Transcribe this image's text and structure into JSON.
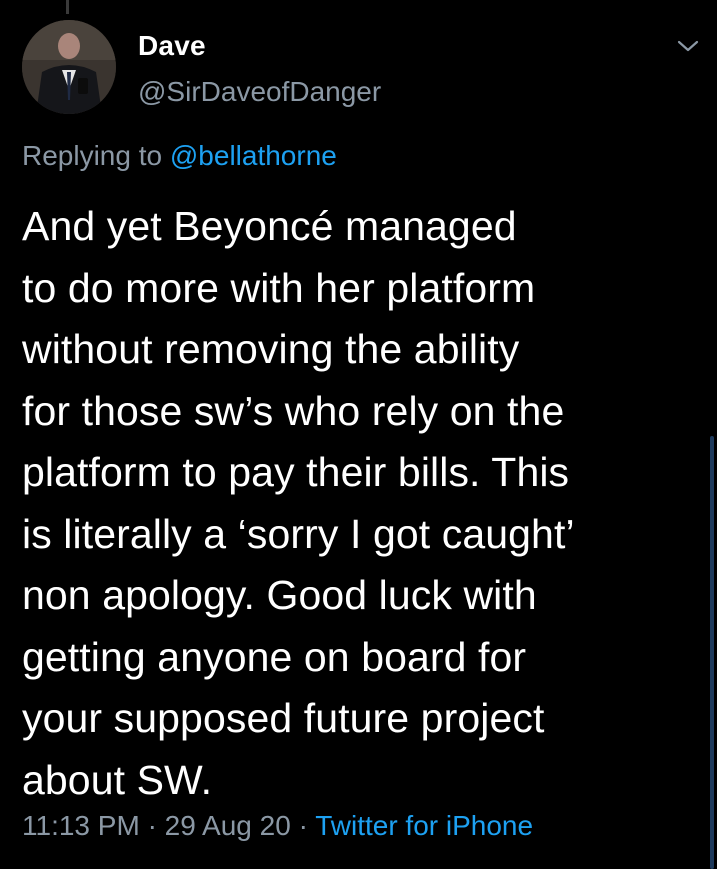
{
  "author": {
    "name": "Dave",
    "handle": "@SirDaveofDanger"
  },
  "reply": {
    "prefix": "Replying to",
    "to": "@bellathorne"
  },
  "tweet": {
    "text": "And yet Beyoncé managed\nto do more with her platform\nwithout removing the ability\nfor those sw’s who rely on the\nplatform to pay their bills. This\nis literally a ‘sorry I got caught’\nnon apology. Good luck with\ngetting anyone on board for\nyour supposed future project\nabout SW."
  },
  "meta": {
    "time": "11:13 PM",
    "separator": "·",
    "date": "29 Aug 20",
    "source": "Twitter for iPhone"
  },
  "icons": {
    "avatar": "profile-photo",
    "menu": "chevron-down-icon"
  },
  "colors": {
    "background": "#000000",
    "text": "#ffffff",
    "secondary": "#8b98a5",
    "link": "#1da1f2"
  }
}
